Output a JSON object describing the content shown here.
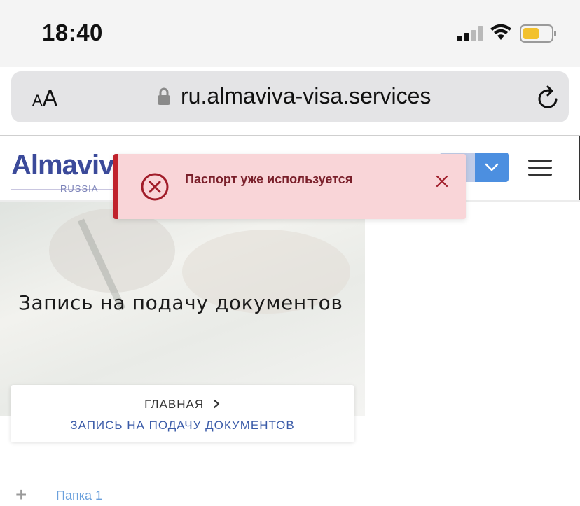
{
  "status_bar": {
    "time": "18:40",
    "signal_icon": "cellular-signal-icon",
    "wifi_icon": "wifi-icon",
    "battery_icon": "battery-icon",
    "battery_color": "#f2c12e"
  },
  "browser": {
    "text_size_button": {
      "small": "A",
      "large": "A"
    },
    "url": "ru.almaviva-visa.services",
    "lock_icon": "lock-icon",
    "reload_icon": "reload-icon"
  },
  "site_header": {
    "logo": {
      "word": "Almaviva",
      "subtitle": "RUSSIA"
    },
    "icons": [
      "globe-icon",
      "user-icon",
      "chevron-down-icon",
      "menu-icon"
    ],
    "accent_color": "#4c8fe0"
  },
  "toast": {
    "message": "Паспорт уже используется",
    "icon": "error-circle-icon",
    "close_icon": "close-icon",
    "background_color": "#f9d5d8",
    "accent_color": "#c0222c"
  },
  "hero": {
    "title": "Запись на подачу документов"
  },
  "breadcrumb": {
    "home": "ГЛАВНАЯ",
    "current": "ЗАПИСЬ НА ПОДАЧУ ДОКУМЕНТОВ"
  },
  "folder": {
    "expand_icon": "plus-icon",
    "label": "Папка 1"
  }
}
